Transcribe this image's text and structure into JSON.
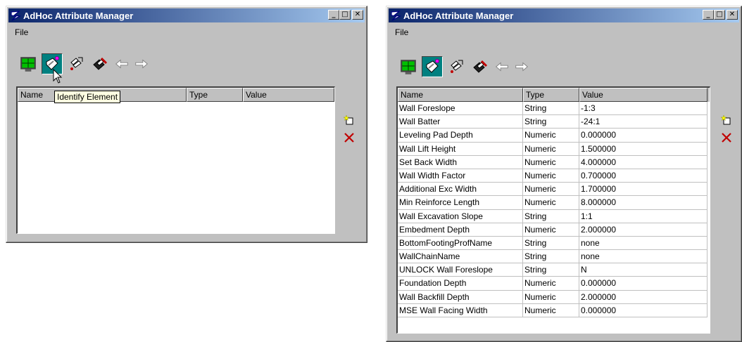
{
  "window_title": "AdHoc Attribute Manager",
  "menu": {
    "file": "File"
  },
  "caption": {
    "minimize": "_",
    "maximize": "□",
    "close": "✕"
  },
  "toolbar": {
    "buttons": [
      "monitor-icon",
      "identify-element-icon",
      "tag-attach-icon",
      "tag-edit-icon",
      "back-arrow-icon",
      "forward-arrow-icon"
    ]
  },
  "tooltip": "Identify Element",
  "columns": {
    "name": "Name",
    "type": "Type",
    "value": "Value"
  },
  "side_buttons": [
    "new-attribute-icon",
    "delete-icon"
  ],
  "rows": [
    {
      "name": "Wall Foreslope",
      "type": "String",
      "value": "-1:3"
    },
    {
      "name": "Wall Batter",
      "type": "String",
      "value": "-24:1"
    },
    {
      "name": "Leveling Pad Depth",
      "type": "Numeric",
      "value": "0.000000"
    },
    {
      "name": "Wall Lift Height",
      "type": "Numeric",
      "value": "1.500000"
    },
    {
      "name": "Set Back Width",
      "type": "Numeric",
      "value": "4.000000"
    },
    {
      "name": "Wall Width Factor",
      "type": "Numeric",
      "value": "0.700000"
    },
    {
      "name": "Additional Exc Width",
      "type": "Numeric",
      "value": "1.700000"
    },
    {
      "name": "Min Reinforce Length",
      "type": "Numeric",
      "value": "8.000000"
    },
    {
      "name": "Wall Excavation Slope",
      "type": "String",
      "value": "1:1"
    },
    {
      "name": "Embedment Depth",
      "type": "Numeric",
      "value": "2.000000"
    },
    {
      "name": "BottomFootingProfName",
      "type": "String",
      "value": "none"
    },
    {
      "name": "WallChainName",
      "type": "String",
      "value": "none"
    },
    {
      "name": "UNLOCK Wall Foreslope",
      "type": "String",
      "value": "N"
    },
    {
      "name": "Foundation Depth",
      "type": "Numeric",
      "value": "0.000000"
    },
    {
      "name": "Wall Backfill Depth",
      "type": "Numeric",
      "value": "2.000000"
    },
    {
      "name": "MSE Wall Facing Width",
      "type": "Numeric",
      "value": "0.000000"
    }
  ],
  "colors": {
    "title_start": "#0a246a",
    "title_end": "#a6caf0",
    "pressed_bg": "#008080",
    "delete_red": "#c00000"
  }
}
